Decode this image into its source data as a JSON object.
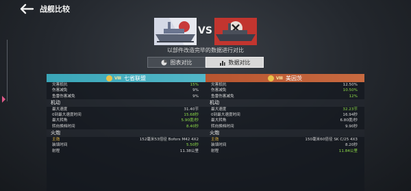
{
  "header": {
    "title": "战舰比较"
  },
  "compare": {
    "vs": "VS",
    "subtitle": "以部件改造完毕的数据进行对比",
    "tabs": [
      {
        "label": "图表对比",
        "active": false
      },
      {
        "label": "数据对比",
        "active": true
      }
    ]
  },
  "left": {
    "level": "Ⅷ",
    "name": "七省联盟",
    "rows_top": [
      {
        "label": "灾害抵抗",
        "value": "15%",
        "color": "green"
      },
      {
        "label": "伤害减免",
        "value": "9%",
        "color": "gray"
      },
      {
        "label": "鱼雷伤害减免",
        "value": "9%",
        "color": "gray"
      }
    ],
    "mobility_title": "机动",
    "mobility": [
      {
        "label": "最大速度",
        "value": "31.40节",
        "color": "gray"
      },
      {
        "label": "0到最大速度时间",
        "value": "15.68秒",
        "color": "green"
      },
      {
        "label": "最大转角",
        "value": "5.90度/秒",
        "color": "green"
      },
      {
        "label": "转向换档时间",
        "value": "8.40秒",
        "color": "green"
      }
    ],
    "firepower_title": "火炮",
    "firepower": [
      {
        "label": "主炮",
        "value": "152毫米53倍径 Bofors M42 4X2",
        "color": "gray",
        "hl": true
      },
      {
        "label": "装填时间",
        "value": "5.50秒",
        "color": "green"
      },
      {
        "label": "射程",
        "value": "11.38公里",
        "color": "gray"
      }
    ]
  },
  "right": {
    "level": "Ⅷ",
    "name": "美因茨",
    "rows_top": [
      {
        "label": "灾害抵抗",
        "value": "12.50%",
        "color": "gray"
      },
      {
        "label": "伤害减免",
        "value": "10.50%",
        "color": "green"
      },
      {
        "label": "鱼雷伤害减免",
        "value": "12%",
        "color": "green"
      }
    ],
    "mobility_title": "机动",
    "mobility": [
      {
        "label": "最大速度",
        "value": "32.23节",
        "color": "green"
      },
      {
        "label": "0到最大速度时间",
        "value": "16.94秒",
        "color": "gray"
      },
      {
        "label": "最大转角",
        "value": "6.80度/秒",
        "color": "gray"
      },
      {
        "label": "转向换档时间",
        "value": "9.90秒",
        "color": "gray"
      }
    ],
    "firepower_title": "火炮",
    "firepower": [
      {
        "label": "主炮",
        "value": "150毫米60倍径 SK C/25 4X3",
        "color": "gray",
        "hl": true
      },
      {
        "label": "装填时间",
        "value": "8.20秒",
        "color": "gray"
      },
      {
        "label": "射程",
        "value": "11.84公里",
        "color": "green"
      }
    ]
  },
  "colors": {
    "better": "#8edc48",
    "left_header": "#3aa6b8",
    "right_header": "#b85530"
  }
}
